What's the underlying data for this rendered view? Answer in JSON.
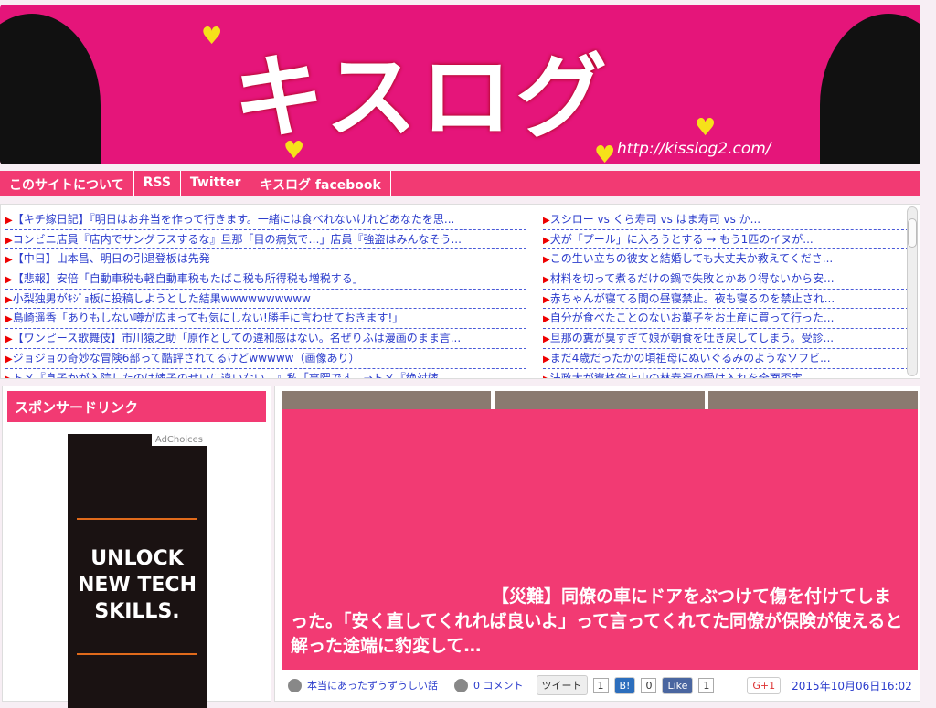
{
  "banner": {
    "logo": "キスログ",
    "url": "http://kisslog2.com/"
  },
  "nav": [
    "このサイトについて",
    "RSS",
    "Twitter",
    "キスログ facebook"
  ],
  "links_left": [
    "【キチ嫁日記】『明日はお弁当を作って行きます。一緒には食べれないけれどあなたを思...",
    "コンビニ店員『店内でサングラスするな』旦那「目の病気で…」店員『強盗はみんなそう...",
    "【中日】山本昌、明日の引退登板は先発",
    "【悲報】安倍「自動車税も軽自動車税もたばこ税も所得税も増税する」",
    "小梨独男がｷｼﾞｮ板に投稿しようとした結果wwwwwwwwww",
    "島崎遥香「ありもしない噂が広まっても気にしない!勝手に言わせておきます!」",
    "【ワンピース歌舞伎】市川猿之助「原作としての違和感はない。名ぜりふは漫画のまま言...",
    "ジョジョの奇妙な冒険6部って酷評されてるけどwwwww（画像あり）",
    "トメ『息子かが入院したのは嫁子のせいに違いない…』私「高隈です」→トメ『絶対嫁"
  ],
  "links_right": [
    "スシロー vs くら寿司 vs はま寿司 vs か...",
    "犬が「プール」に入ろうとする → もう1匹のイヌが...",
    "この生い立ちの彼女と結婚しても大丈夫か教えてくださ...",
    "材料を切って煮るだけの鍋で失敗とかあり得ないから安...",
    "赤ちゃんが寝てる間の昼寝禁止。夜も寝るのを禁止され...",
    "自分が食べたことのないお菓子をお土産に買って行った...",
    "旦那の糞が臭すぎて娘が朝食を吐き戻してしまう。受診...",
    "まだ4歳だったかの頃祖母にぬいぐるみのようなソフビ...",
    "法政大が資格停止中の林春福の受け入れを全面否定"
  ],
  "sidebar": {
    "title": "スポンサードリンク",
    "ad_choices": "AdChoices",
    "ad_text": "UNLOCK NEW TECH SKILLS."
  },
  "article": {
    "title": "【災難】同僚の車にドアをぶつけて傷を付けてしまった。「安く直してくれれば良いよ」って言ってくれてた同僚が保険が使えると解った途端に豹変して…",
    "category": "本当にあったずうずうしい話",
    "comments": "0 コメント",
    "tweet": "ツイート",
    "tweet_count": "1",
    "hatena": "B!",
    "hatena_count": "0",
    "like": "Like",
    "like_count": "1",
    "gplus": "G+1",
    "date": "2015年10月06日16:02"
  }
}
